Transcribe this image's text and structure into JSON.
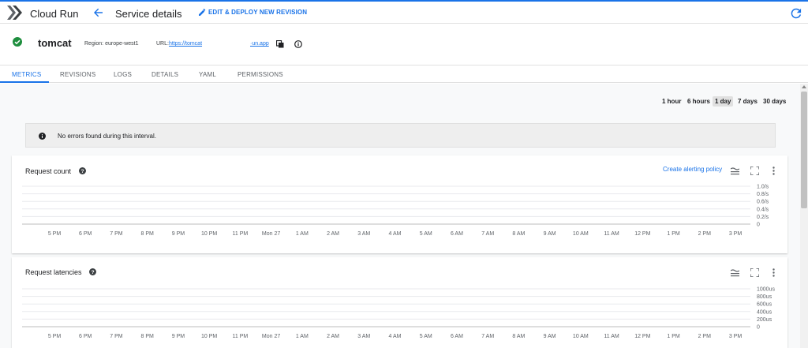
{
  "topbar": {
    "app_title": "Cloud Run",
    "page_title": "Service details",
    "edit_deploy_label": "EDIT & DEPLOY NEW REVISION"
  },
  "service": {
    "name": "tomcat",
    "region": "Region: europe-west1",
    "url_label": "URL:",
    "url_start": "https://tomcat",
    "url_end": "·un.app"
  },
  "tabs": [
    "METRICS",
    "REVISIONS",
    "LOGS",
    "DETAILS",
    "YAML",
    "PERMISSIONS"
  ],
  "time_ranges": [
    {
      "label": "1 hour",
      "selected": false
    },
    {
      "label": "6 hours",
      "selected": false
    },
    {
      "label": "1 day",
      "selected": true
    },
    {
      "label": "7 days",
      "selected": false
    },
    {
      "label": "30 days",
      "selected": false
    }
  ],
  "banner": {
    "text": "No errors found during this interval."
  },
  "charts": [
    {
      "title": "Request count",
      "alert_link": "Create alerting policy",
      "x_ticks": [
        "5 PM",
        "6 PM",
        "7 PM",
        "8 PM",
        "9 PM",
        "10 PM",
        "11 PM",
        "Mon 27",
        "1 AM",
        "2 AM",
        "3 AM",
        "4 AM",
        "5 AM",
        "6 AM",
        "7 AM",
        "8 AM",
        "9 AM",
        "10 AM",
        "11 AM",
        "12 PM",
        "1 PM",
        "2 PM",
        "3 PM"
      ],
      "y_ticks": [
        "1.0/s",
        "0.8/s",
        "0.6/s",
        "0.4/s",
        "0.2/s",
        "0"
      ]
    },
    {
      "title": "Request latencies",
      "alert_link": "",
      "x_ticks": [
        "5 PM",
        "6 PM",
        "7 PM",
        "8 PM",
        "9 PM",
        "10 PM",
        "11 PM",
        "Mon 27",
        "1 AM",
        "2 AM",
        "3 AM",
        "4 AM",
        "5 AM",
        "6 AM",
        "7 AM",
        "8 AM",
        "9 AM",
        "10 AM",
        "11 AM",
        "12 PM",
        "1 PM",
        "2 PM",
        "3 PM"
      ],
      "y_ticks": [
        "1000us",
        "800us",
        "600us",
        "400us",
        "200us",
        "0"
      ]
    }
  ],
  "icons": {
    "logo": "cloud-run-logo",
    "back": "arrow-left-icon",
    "edit": "pencil-icon",
    "refresh": "refresh-icon",
    "status": "check-circle-icon",
    "copy": "copy-icon",
    "info": "info-icon",
    "banner": "info-filled-icon",
    "help": "help-icon",
    "legend": "legend-icon",
    "fullscreen": "fullscreen-icon",
    "more": "more-vert-icon"
  },
  "colors": {
    "accent": "#1a73e8",
    "success": "#1e8e3e"
  }
}
